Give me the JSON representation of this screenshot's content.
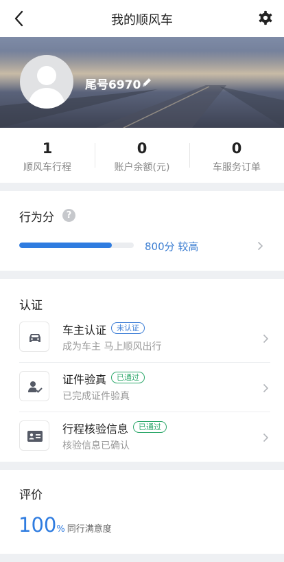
{
  "nav": {
    "title": "我的顺风车"
  },
  "profile": {
    "nickname": "尾号6970"
  },
  "stats": [
    {
      "value": "1",
      "label": "顺风车行程"
    },
    {
      "value": "0",
      "label": "账户余额(元)"
    },
    {
      "value": "0",
      "label": "车服务订单"
    }
  ],
  "behavior": {
    "title": "行为分",
    "help_mark": "?",
    "score_text": "800分 较高",
    "progress": 0.81,
    "bar_color": "#2f7ce0"
  },
  "verification": {
    "title": "认证",
    "items": [
      {
        "icon": "car-icon",
        "title": "车主认证",
        "badge": "未认证",
        "badge_color": "#3d7ed6",
        "subtitle": "成为车主 马上顺风出行"
      },
      {
        "icon": "user-check-icon",
        "title": "证件验真",
        "badge": "已通过",
        "badge_color": "#2ea86b",
        "subtitle": "已完成证件验真"
      },
      {
        "icon": "id-card-icon",
        "title": "行程核验信息",
        "badge": "已通过",
        "badge_color": "#2ea86b",
        "subtitle": "核验信息已确认"
      }
    ]
  },
  "rating": {
    "title": "评价",
    "value": "100",
    "unit": "%",
    "label": "同行满意度"
  }
}
